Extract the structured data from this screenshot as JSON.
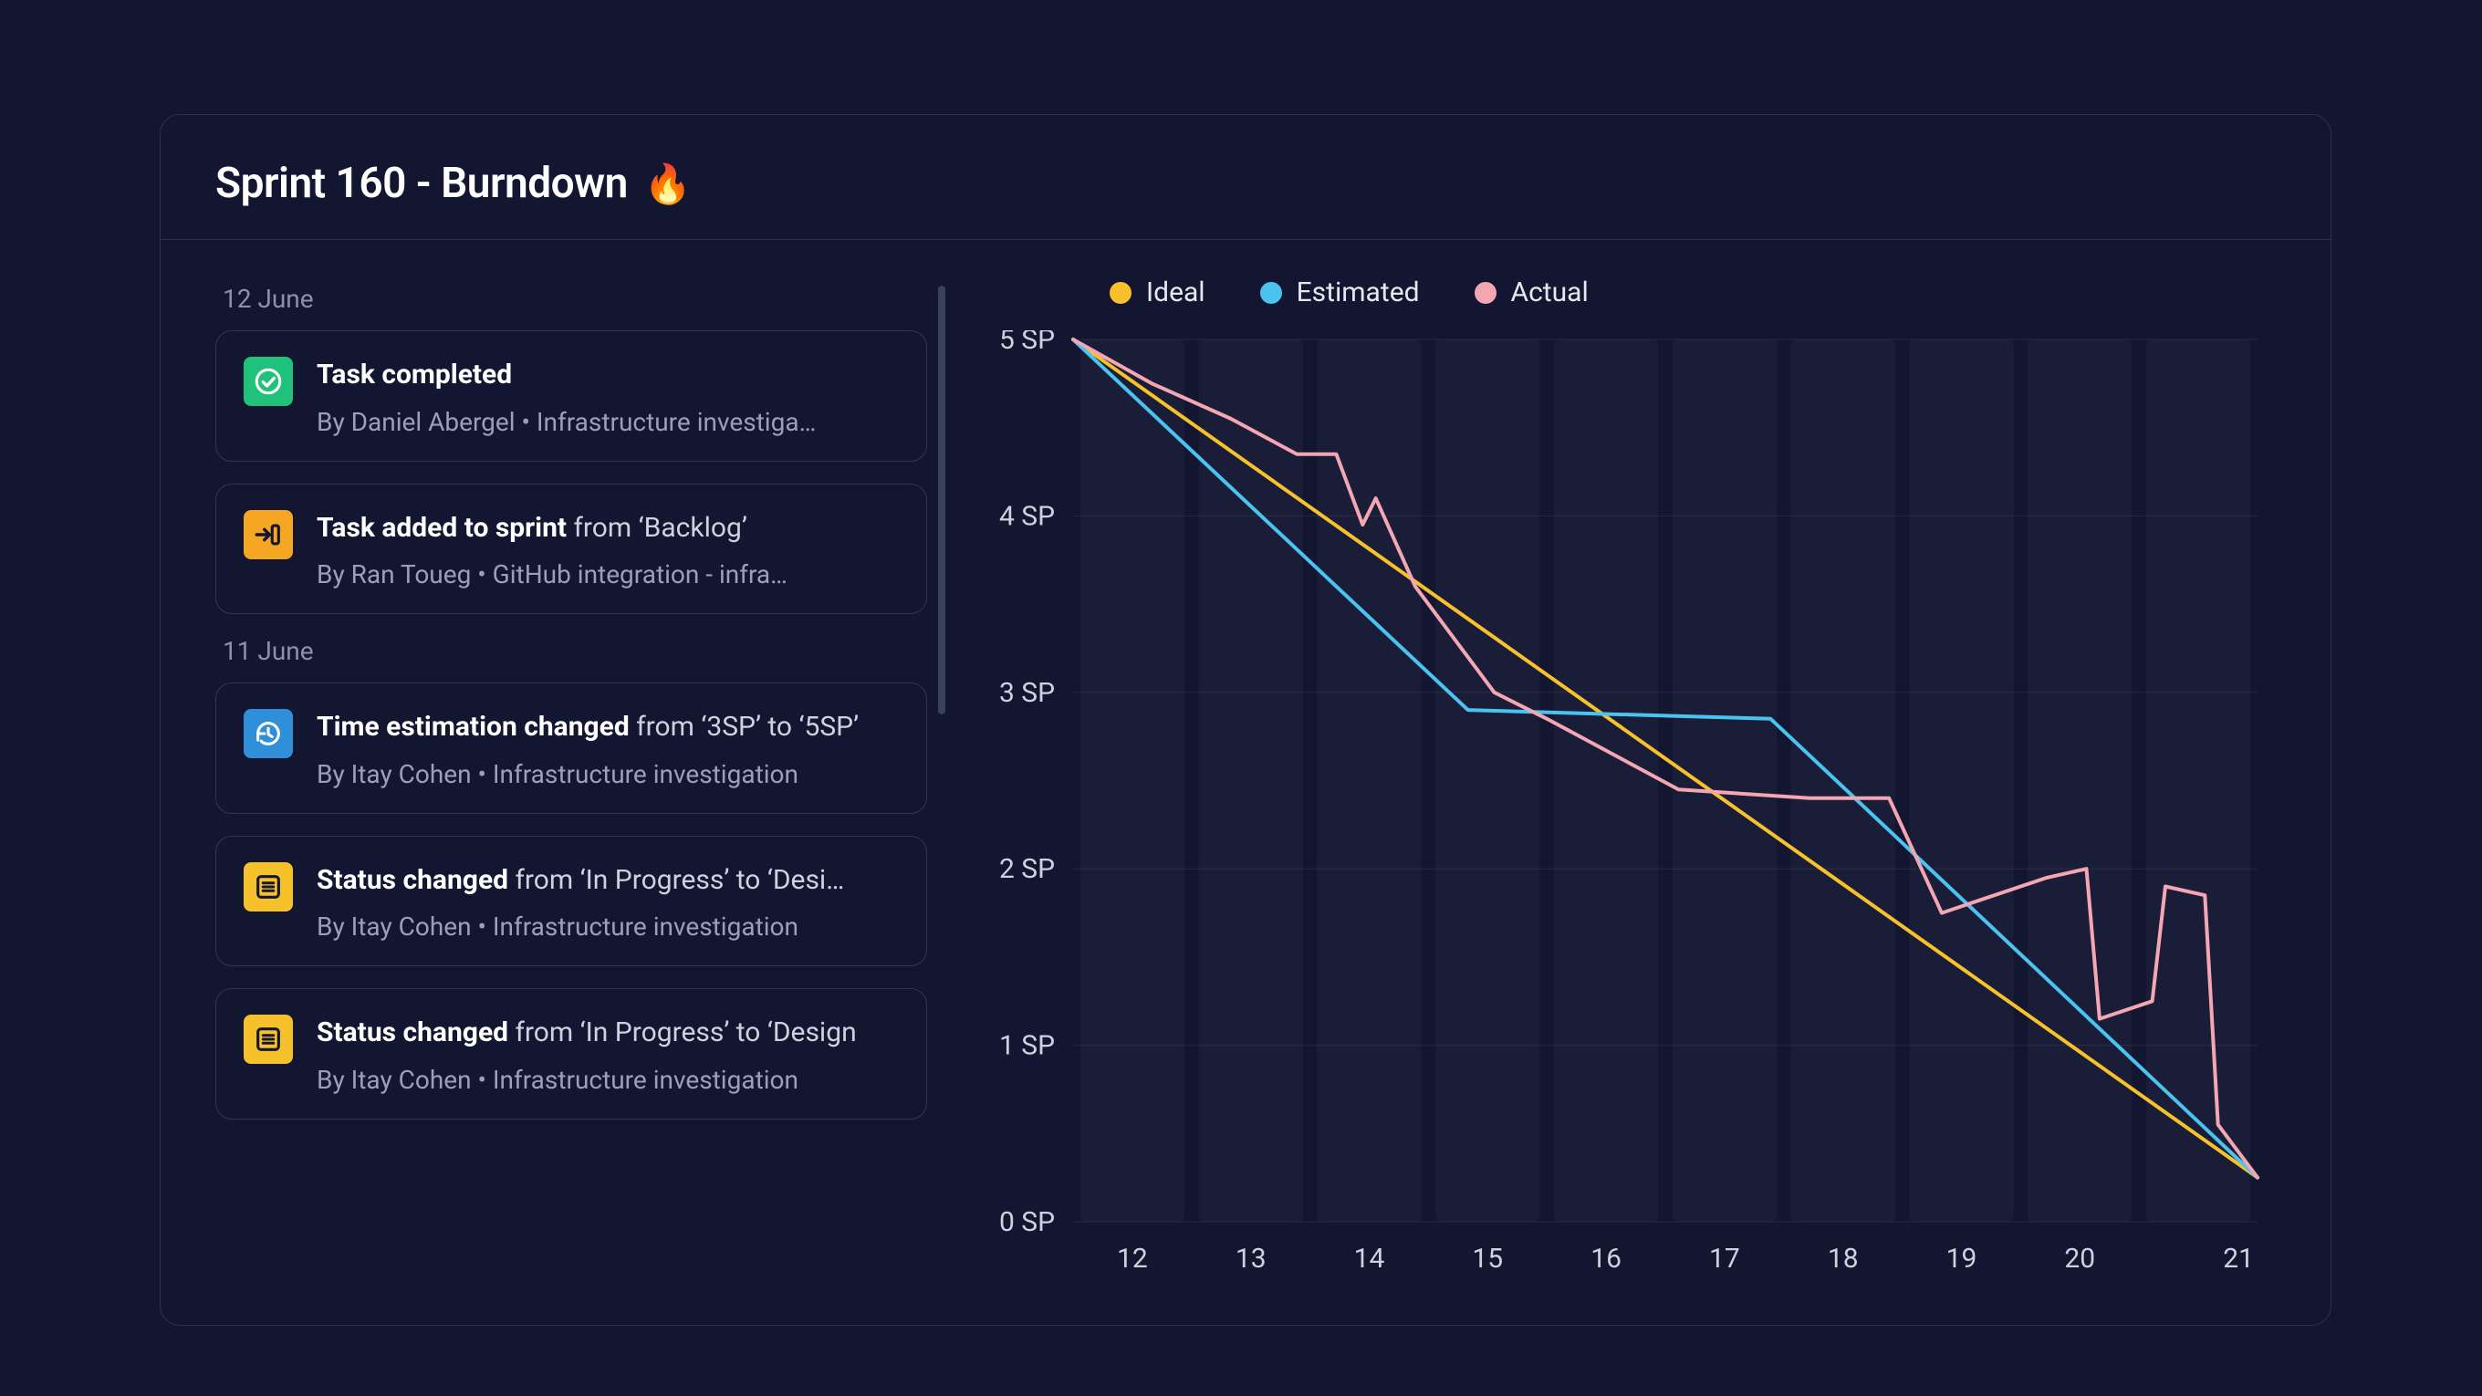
{
  "header": {
    "title": "Sprint 160 - Burndown",
    "emoji": "🔥"
  },
  "colors": {
    "ideal": "#f6c12a",
    "estimated": "#4bc3f1",
    "actual": "#f4a6b2",
    "icon_green": "#1fc17b",
    "icon_orange": "#f5a623",
    "icon_blue": "#2f8fd8",
    "icon_yellow": "#f6c12a"
  },
  "feed": {
    "groups": [
      {
        "date": "12 June",
        "items": [
          {
            "icon": "check-circle-icon",
            "icon_bg": "#1fc17b",
            "title_bold": "Task completed",
            "title_rest": "",
            "byline": "By Daniel Abergel • Infrastructure investiga…"
          },
          {
            "icon": "move-in-icon",
            "icon_bg": "#f5a623",
            "title_bold": "Task added to sprint",
            "title_rest": " from ‘Backlog’",
            "byline": "By Ran Toueg • GitHub integration - infra…"
          }
        ]
      },
      {
        "date": "11 June",
        "items": [
          {
            "icon": "history-icon",
            "icon_bg": "#2f8fd8",
            "title_bold": "Time estimation changed",
            "title_rest": " from ‘3SP’ to ‘5SP’",
            "byline": "By Itay Cohen • Infrastructure investigation"
          },
          {
            "icon": "list-icon",
            "icon_bg": "#f6c12a",
            "title_bold": "Status changed",
            "title_rest": " from ‘In Progress’ to ‘Desi…",
            "byline": "By Itay Cohen • Infrastructure investigation"
          },
          {
            "icon": "list-icon",
            "icon_bg": "#f6c12a",
            "title_bold": "Status changed",
            "title_rest": " from ‘In Progress’ to ‘Design",
            "byline": "By Itay Cohen • Infrastructure investigation"
          }
        ]
      }
    ]
  },
  "legend": {
    "ideal": "Ideal",
    "estimated": "Estimated",
    "actual": "Actual"
  },
  "chart_data": {
    "type": "line",
    "title": "Sprint 160 - Burndown",
    "xlabel": "",
    "ylabel": "",
    "y_unit": "SP",
    "xlim": [
      12,
      21
    ],
    "ylim": [
      0,
      5
    ],
    "x_ticks": [
      12,
      13,
      14,
      15,
      16,
      17,
      18,
      19,
      20,
      21
    ],
    "y_ticks": [
      0,
      1,
      2,
      3,
      4,
      5
    ],
    "y_tick_labels": [
      "0 SP",
      "1 SP",
      "2 SP",
      "3 SP",
      "4 SP",
      "5 SP"
    ],
    "series": [
      {
        "name": "Ideal",
        "color": "#f6c12a",
        "x": [
          12,
          21
        ],
        "y": [
          5,
          0.25
        ]
      },
      {
        "name": "Estimated",
        "color": "#4bc3f1",
        "x": [
          12,
          15,
          17.3,
          21
        ],
        "y": [
          5,
          2.9,
          2.85,
          0.25
        ]
      },
      {
        "name": "Actual",
        "color": "#f4a6b2",
        "x": [
          12,
          12.6,
          13.2,
          13.7,
          14.0,
          14.2,
          14.3,
          14.6,
          15.2,
          15.6,
          16.6,
          17.6,
          18.2,
          18.6,
          19.4,
          19.7,
          19.8,
          20.2,
          20.3,
          20.6,
          20.7,
          21.0
        ],
        "y": [
          5,
          4.75,
          4.55,
          4.35,
          4.35,
          3.95,
          4.1,
          3.6,
          3.0,
          2.85,
          2.45,
          2.4,
          2.4,
          1.75,
          1.95,
          2.0,
          1.15,
          1.25,
          1.9,
          1.85,
          0.55,
          0.25
        ]
      }
    ]
  }
}
